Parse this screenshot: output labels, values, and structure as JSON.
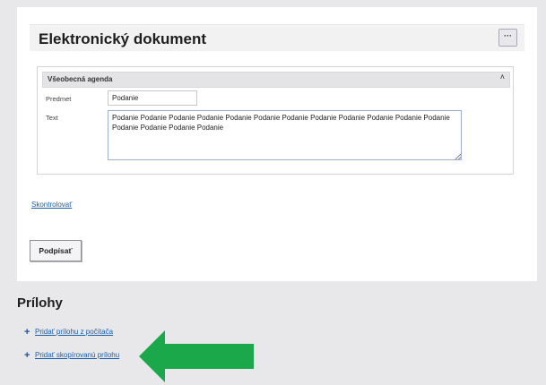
{
  "document": {
    "title": "Elektronický dokument",
    "more_label": "···"
  },
  "section": {
    "title": "Všeobecná agenda",
    "collapse_glyph": "˄"
  },
  "form": {
    "subject_label": "Predmet",
    "subject_value": "Podanie",
    "text_label": "Text",
    "text_value": "Podanie Podanie Podanie Podanie Podanie Podanie Podanie Podanie Podanie Podanie Podanie Podanie Podanie Podanie Podanie Podanie"
  },
  "actions": {
    "check_label": "Skontrolovať",
    "sign_label": "Podpísať"
  },
  "attachments": {
    "title": "Prílohy",
    "items": [
      {
        "icon": "plus-icon",
        "label": "Pridať prílohu z počítača"
      },
      {
        "icon": "plus-icon",
        "label": "Pridať skopírovanú prílohu"
      }
    ]
  },
  "colors": {
    "link": "#1a5faa",
    "arrow": "#1aa84b",
    "background": "#e8e8ea"
  }
}
